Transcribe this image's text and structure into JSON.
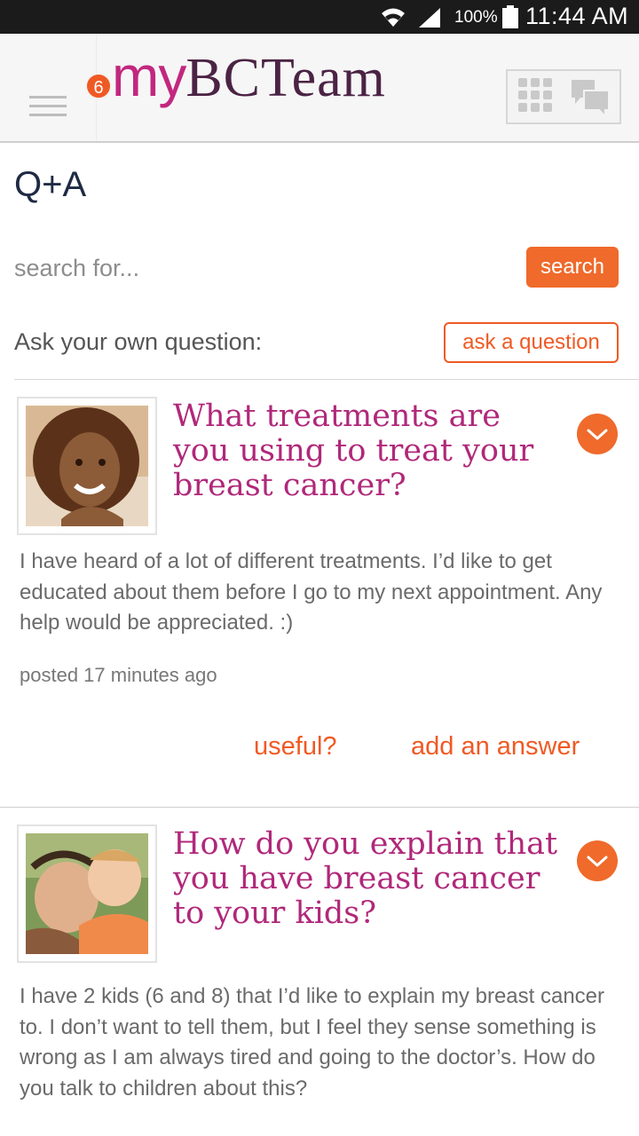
{
  "status_bar": {
    "battery": "100%",
    "time": "11:44 AM"
  },
  "header": {
    "logo_prefix": "my",
    "logo_main": "BCTeam",
    "notification_count": "6",
    "icons": [
      "menu-icon",
      "apps-grid-icon",
      "chat-bubbles-icon"
    ]
  },
  "page": {
    "title": "Q+A"
  },
  "search": {
    "placeholder": "search for...",
    "button_label": "search"
  },
  "ask": {
    "label": "Ask your own question:",
    "button_label": "ask a question"
  },
  "questions": [
    {
      "title": "What treatments are you using to treat your breast cancer?",
      "body": "I have heard of a lot of different treatments. I’d like to get educated about them before I go to my next appointment.  Any help would be appreciated. :)",
      "posted": "posted 17 minutes ago",
      "useful_label": "useful?",
      "answer_label": "add an answer"
    },
    {
      "title": "How do you explain that you have breast cancer to your kids?",
      "body": "I have 2 kids (6 and 8) that I’d like to explain my breast cancer to.  I don’t want to tell them, but I feel they sense something is wrong as I am always tired and going to the doctor’s.  How do you talk to children about this?"
    }
  ],
  "colors": {
    "accent": "#ef6a2b",
    "question_title": "#b0287a",
    "logo_my": "#c2277f",
    "logo_team": "#4b2344"
  }
}
